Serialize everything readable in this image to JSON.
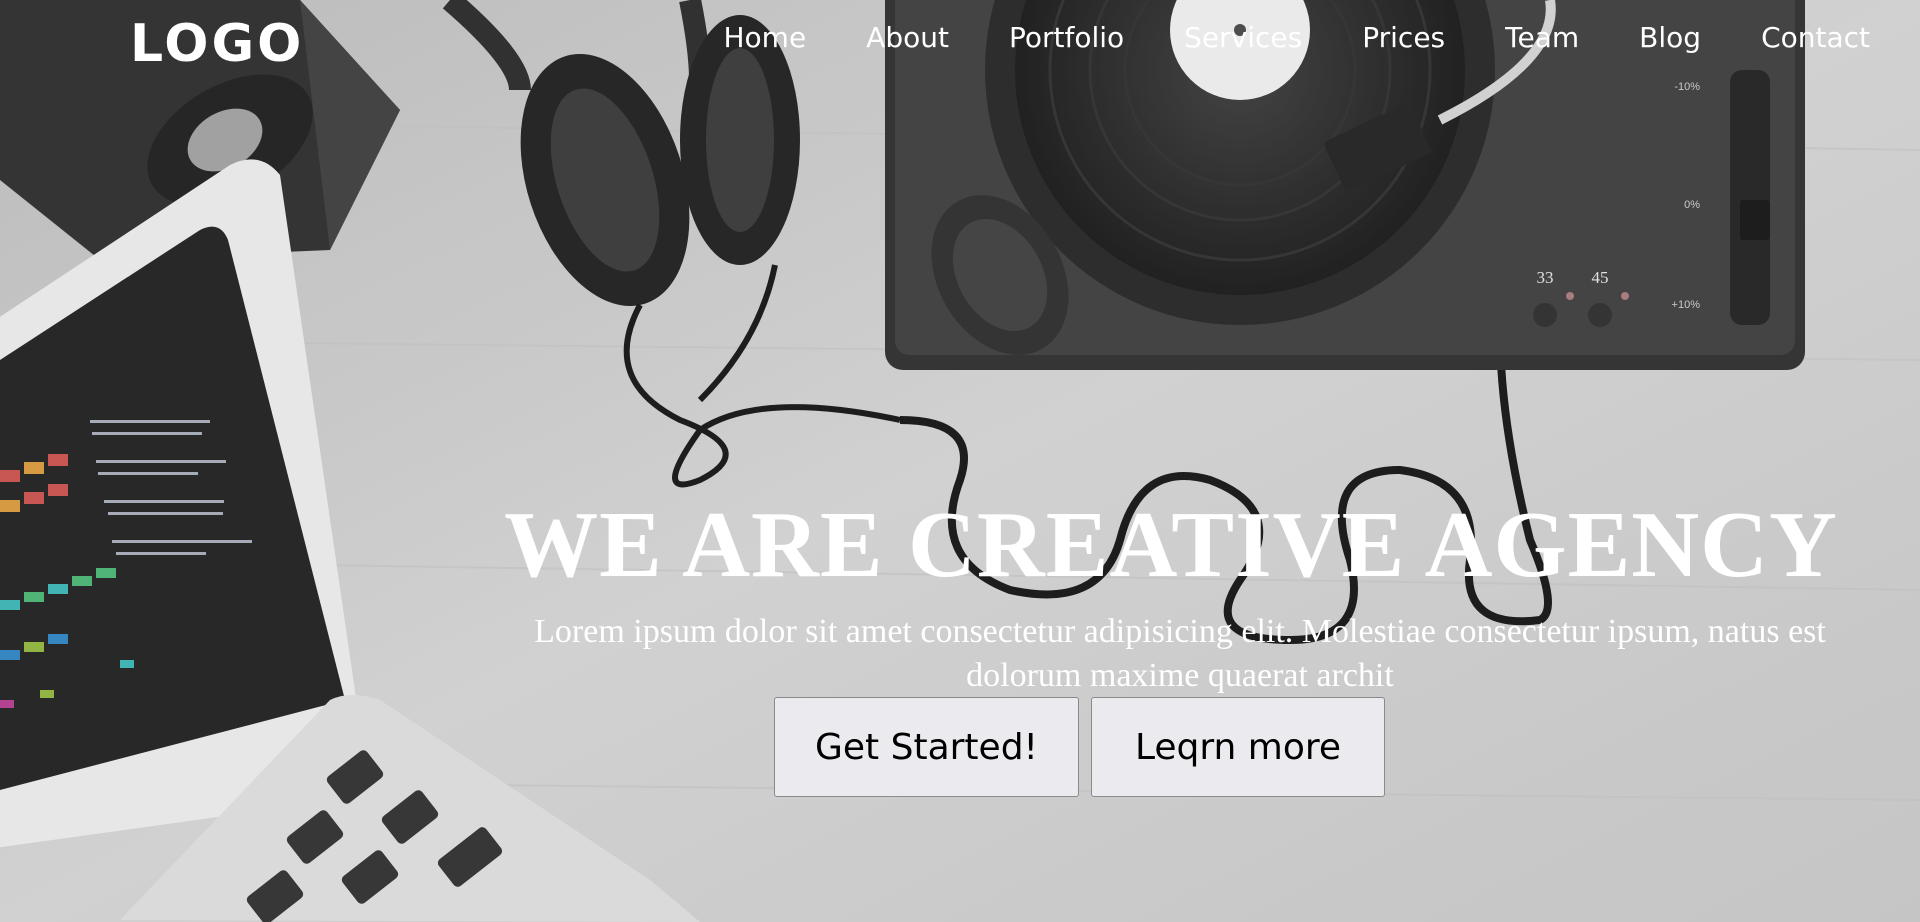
{
  "header": {
    "logo": "LOGO",
    "nav": [
      {
        "label": "Home"
      },
      {
        "label": "About"
      },
      {
        "label": "Portfolio"
      },
      {
        "label": "Services"
      },
      {
        "label": "Prices"
      },
      {
        "label": "Team"
      },
      {
        "label": "Blog"
      },
      {
        "label": "Contact"
      }
    ]
  },
  "hero": {
    "title": "WE ARE CREATIVE AGENCY",
    "subtitle": "Lorem ipsum dolor sit amet consectetur adipisicing elit. Molestiae consectetur ipsum, natus est dolorum maxime quaerat archit",
    "primary_button": "Get Started!",
    "secondary_button": "Leqrn more"
  },
  "background": {
    "turntable_speeds": [
      "33",
      "45"
    ],
    "pitch_marks": [
      "-10%",
      "0%",
      "+10%"
    ]
  },
  "colors": {
    "text": "#ffffff",
    "button_bg": "#ebeaee",
    "button_border": "#8a8a8a"
  }
}
